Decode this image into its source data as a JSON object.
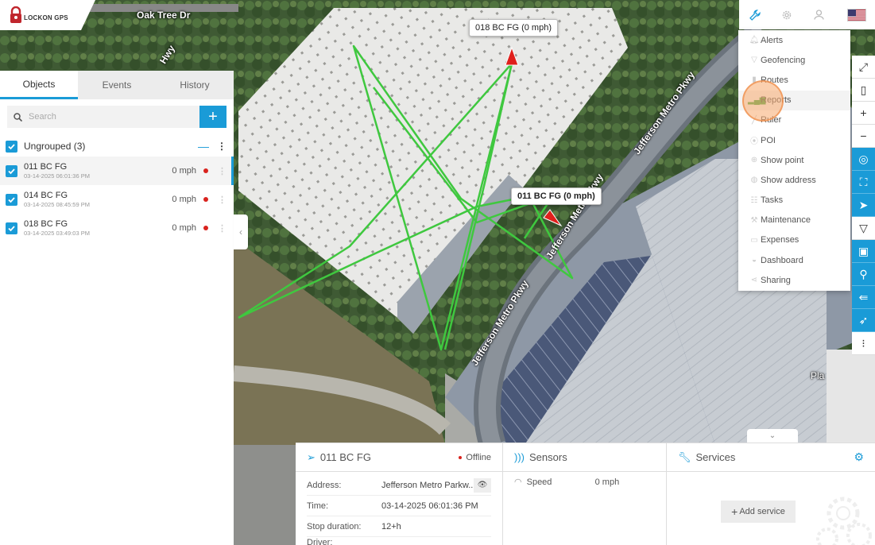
{
  "logo": {
    "text": "LOCKON GPS"
  },
  "map": {
    "road_labels": {
      "oak_tree": "Oak Tree Dr",
      "hwy": "Hwy",
      "jefferson1": "Jefferson Metro Pkwy",
      "jefferson2": "Jefferson Metro Pkwy",
      "jefferson3": "Jefferson Metro Pkwy",
      "plaza": "Pla"
    },
    "tooltips": {
      "t018": "018 BC FG (0 mph)",
      "t011": "011 BC FG (0 mph)"
    }
  },
  "top_bar": {
    "tools_icon": "wrench-icon",
    "settings_icon": "gear-icon",
    "user_icon": "user-icon",
    "language_flag": "us-flag-icon"
  },
  "tools_menu": [
    {
      "label": "Alerts",
      "icon": "bell-icon"
    },
    {
      "label": "Geofencing",
      "icon": "geofence-icon"
    },
    {
      "label": "Routes",
      "icon": "route-icon"
    },
    {
      "label": "Reports",
      "icon": "bar-chart-icon"
    },
    {
      "label": "Ruler",
      "icon": "ruler-icon"
    },
    {
      "label": "POI",
      "icon": "map-pin-icon"
    },
    {
      "label": "Show point",
      "icon": "crosshair-icon"
    },
    {
      "label": "Show address",
      "icon": "globe-icon"
    },
    {
      "label": "Tasks",
      "icon": "tasks-icon"
    },
    {
      "label": "Maintenance",
      "icon": "wrench-icon"
    },
    {
      "label": "Expenses",
      "icon": "money-icon"
    },
    {
      "label": "Dashboard",
      "icon": "dashboard-icon"
    },
    {
      "label": "Sharing",
      "icon": "share-icon"
    }
  ],
  "left_panel": {
    "tabs": [
      "Objects",
      "Events",
      "History"
    ],
    "search_placeholder": "Search",
    "group": {
      "label": "Ungrouped (3)"
    },
    "objects": [
      {
        "name": "011 BC FG",
        "time": "03-14-2025 06:01:36 PM",
        "speed": "0 mph",
        "status_color": "#d9231e"
      },
      {
        "name": "014 BC FG",
        "time": "03-14-2025 08:45:59 PM",
        "speed": "0 mph",
        "status_color": "#d9231e"
      },
      {
        "name": "018 BC FG",
        "time": "03-14-2025 03:49:03 PM",
        "speed": "0 mph",
        "status_color": "#d9231e"
      }
    ]
  },
  "bottom_panel": {
    "object": {
      "title": "011 BC FG",
      "status": "Offline",
      "rows": [
        {
          "key": "Address:",
          "value": "Jefferson Metro Parkw..."
        },
        {
          "key": "Time:",
          "value": "03-14-2025 06:01:36 PM"
        },
        {
          "key": "Stop duration:",
          "value": "12+h"
        },
        {
          "key": "Driver:",
          "value": ""
        }
      ]
    },
    "sensors": {
      "title": "Sensors",
      "rows": [
        {
          "key": "Speed",
          "value": "0 mph"
        }
      ]
    },
    "services": {
      "title": "Services",
      "add_label": "Add service"
    }
  },
  "colors": {
    "accent": "#1a9bd7",
    "track": "#3cc13c",
    "offline": "#d9231e",
    "highlight": "#f7aa6e"
  }
}
